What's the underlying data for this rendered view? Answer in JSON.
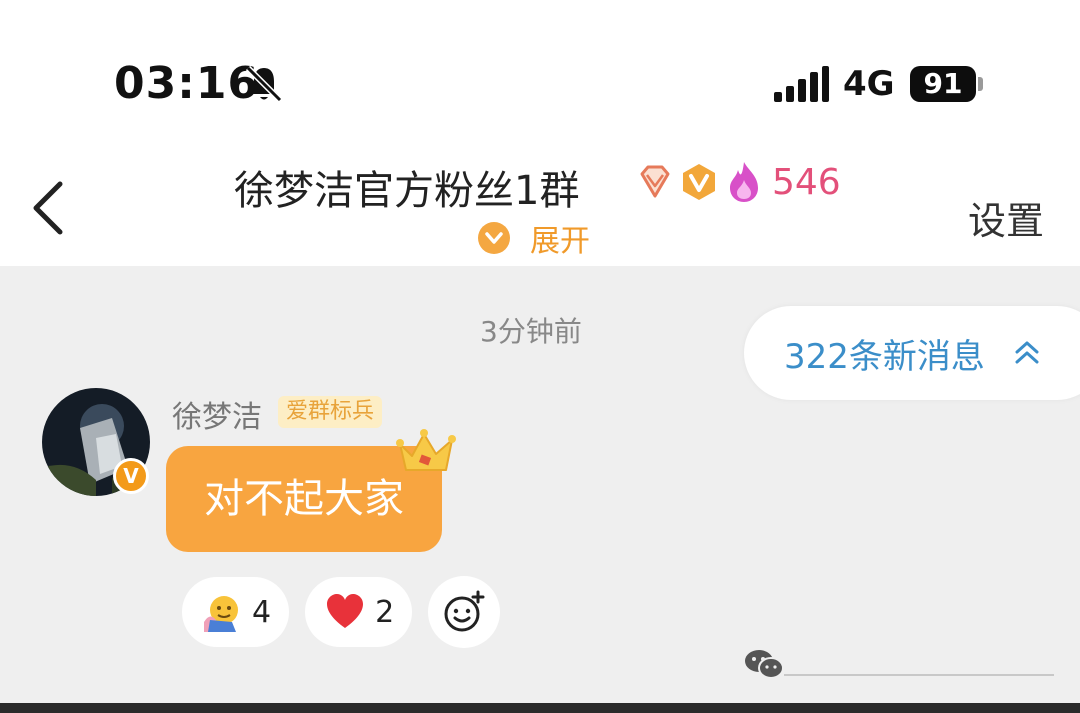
{
  "status_bar": {
    "time": "03:16",
    "network": "4G",
    "battery": "91",
    "icons": [
      "bell-muted-icon",
      "signal-icon"
    ]
  },
  "header": {
    "title": "徐梦洁官方粉丝1群",
    "heat_count": "546",
    "expand_label": "展开",
    "settings_label": "设置",
    "icons": [
      "back-icon",
      "diamond-badge-icon",
      "v-badge-icon",
      "flame-icon",
      "chevron-down-icon"
    ],
    "colors": {
      "heat": "#e3507a",
      "accent": "#f09a2a"
    }
  },
  "chat": {
    "timestamp": "3分钟前",
    "new_messages_label": "322条新消息",
    "message": {
      "sender": "徐梦洁",
      "tag": "爱群标兵",
      "text": "对不起大家",
      "bubble_color": "#f8a540"
    },
    "reactions": [
      {
        "emoji": "hug-emoji-icon",
        "count": "4"
      },
      {
        "emoji": "heart-emoji-icon",
        "count": "2"
      }
    ],
    "add_reaction_icon": "smile-plus-icon"
  }
}
